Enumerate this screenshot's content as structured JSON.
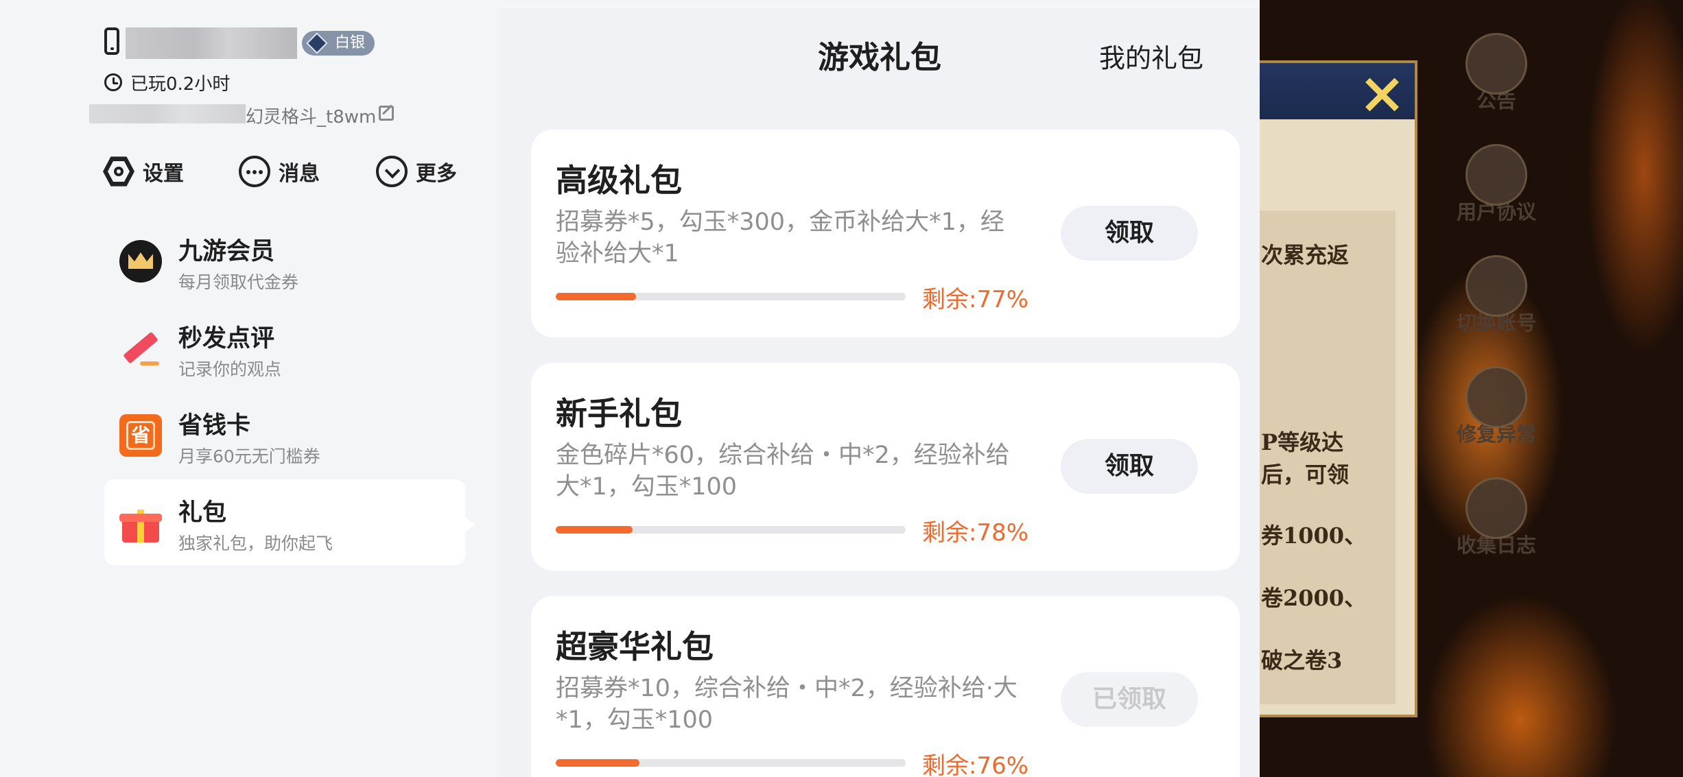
{
  "profile": {
    "badge": "白银",
    "played": "已玩0.2小时",
    "nickname": "幻灵格斗_t8wm"
  },
  "quick_actions": [
    {
      "label": "设置",
      "icon": "settings-icon"
    },
    {
      "label": "消息",
      "icon": "message-icon"
    },
    {
      "label": "更多",
      "icon": "more-icon"
    }
  ],
  "menu": [
    {
      "title": "九游会员",
      "subtitle": "每月领取代金券",
      "icon": "crown-icon"
    },
    {
      "title": "秒发点评",
      "subtitle": "记录你的观点",
      "icon": "pen-icon"
    },
    {
      "title": "省钱卡",
      "subtitle": "月享60元无门槛券",
      "icon": "save-card-icon",
      "icon_char": "省"
    },
    {
      "title": "礼包",
      "subtitle": "独家礼包，助你起飞",
      "icon": "gift-icon",
      "active": true
    }
  ],
  "panel": {
    "title": "游戏礼包",
    "my_gifts": "我的礼包",
    "gifts": [
      {
        "name": "高级礼包",
        "desc": "招募券*5，勾玉*300，金币补给大*1，经验补给大*1",
        "remain_label": "剩余:77%",
        "remain": 0.23,
        "button": "领取",
        "claimed": false
      },
      {
        "name": "新手礼包",
        "desc": "金色碎片*60，综合补给・中*2，经验补给大*1，勾玉*100",
        "remain_label": "剩余:78%",
        "remain": 0.22,
        "button": "领取",
        "claimed": false
      },
      {
        "name": "超豪华礼包",
        "desc": "招募券*10，综合补给・中*2，经验补给·大*1，勾玉*100",
        "remain_label": "剩余:76%",
        "remain": 0.24,
        "button": "已领取",
        "claimed": true
      }
    ]
  },
  "game": {
    "side_buttons": [
      "公告",
      "用户协议",
      "切换账号",
      "修复异常",
      "收集日志"
    ],
    "scroll_lines": [
      "次累充返",
      "P等级达",
      "后，可领",
      "券1000、",
      "卷2000、",
      "破之卷3"
    ]
  },
  "colors": {
    "accent": "#ef6a2c",
    "progress": "#f26a2e",
    "badge": "#8592a8"
  }
}
